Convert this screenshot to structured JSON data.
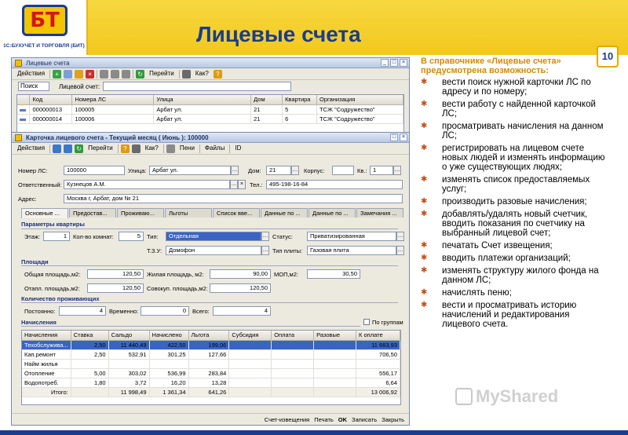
{
  "slide": {
    "title": "Лицевые счета",
    "logo_text": "БТ",
    "logo_caption": "1С:БУХУЧЕТ И ТОРГОВЛЯ (БИТ)",
    "page_number": "10",
    "watermark": "MyShared"
  },
  "list_window": {
    "title": "Лицевые счета",
    "toolbar": {
      "actions": "Действия",
      "goto": "Перейти",
      "help": "Как?"
    },
    "search_button": "Поиск",
    "search_label": "Лицевой счет:",
    "columns": [
      "Код",
      "Номера ЛС",
      "Улица",
      "Дом",
      "Квартира",
      "Организация"
    ],
    "rows": [
      [
        "000000013",
        "100005",
        "Арбат ул.",
        "21",
        "5",
        "ТСЖ \"Содружество\""
      ],
      [
        "000000014",
        "100006",
        "Арбат ул.",
        "21",
        "6",
        "ТСЖ \"Содружество\""
      ]
    ]
  },
  "card_window": {
    "title": "Карточка лицевого счета - Текущий месяц ( Июнь ): 100000",
    "toolbar": {
      "actions": "Действия",
      "goto": "Перейти",
      "help": "Как?",
      "penalty": "Пени",
      "files": "Файлы",
      "id": "ID"
    },
    "fields": {
      "account_label": "Номер ЛС:",
      "account_value": "100000",
      "street_label": "Улица:",
      "street_value": "Арбат ул.",
      "house_label": "Дом:",
      "house_value": "21",
      "building_label": "Корпус:",
      "building_value": "",
      "apartment_label": "Кв.:",
      "apartment_value": "1",
      "owner_label": "Ответственный:",
      "owner_value": "Кузнецов А.М.",
      "phone_label": "Тел.:",
      "phone_value": "495-198-16-84",
      "address_label": "Адрес:",
      "address_value": "Москва г, Арбат, дом № 21"
    },
    "tabs": [
      "Основные ...",
      "Предостав...",
      "Проживаю...",
      "Льготы",
      "Список вве...",
      "Данные по ...",
      "Данные по ...",
      "Замечания ..."
    ],
    "apartment_params": {
      "header": "Параметры квартиры",
      "floor_label": "Этаж:",
      "floor_value": "1",
      "rooms_label": "Кол-во комнат:",
      "rooms_value": "5",
      "type_label": "Тип:",
      "type_value": "Отдельная",
      "status_label": "Статус:",
      "status_value": "Приватизированная",
      "tzu_label": "Т.З.У:",
      "tzu_value": "Домофон",
      "stove_label": "Тип плиты:",
      "stove_value": "Газовая плита"
    },
    "areas": {
      "header": "Площади",
      "total_label": "Общая площадь,м2:",
      "total_value": "120,50",
      "living_label": "Жилая площадь, м2:",
      "living_value": "90,00",
      "mop_label": "МОП,м2:",
      "mop_value": "30,50",
      "heated_label": "Отапл. площадь,м2:",
      "heated_value": "120,50",
      "combined_label": "Совокуп. площадь,м2:",
      "combined_value": "120,50"
    },
    "residents": {
      "header": "Количество проживающих",
      "permanent_label": "Постоянно:",
      "permanent_value": "4",
      "temporary_label": "Временно:",
      "temporary_value": "0",
      "total_label": "Всего:",
      "total_value": "4"
    },
    "charges": {
      "header": "Начисления",
      "by_groups_label": "По группам",
      "columns": [
        "Начисления",
        "Ставка",
        "Сальдо",
        "Начислено",
        "Льгота",
        "Субсидия",
        "Оплата",
        "Разовые",
        "К оплате"
      ],
      "rows": [
        [
          "Техобслужива...",
          "2,50",
          "11 440,49",
          "422,50",
          "199,06",
          "",
          "",
          "",
          "11 663,93"
        ],
        [
          "Кап.ремонт",
          "2,50",
          "532,91",
          "301,25",
          "127,66",
          "",
          "",
          "",
          "706,50"
        ],
        [
          "Найм жилья",
          "",
          "",
          "",
          "",
          "",
          "",
          "",
          ""
        ],
        [
          "Отопление",
          "5,00",
          "303,02",
          "536,99",
          "283,84",
          "",
          "",
          "",
          "556,17"
        ],
        [
          "Водопотреб.",
          "1,80",
          "3,72",
          "16,20",
          "13,28",
          "",
          "",
          "",
          "6,64"
        ]
      ],
      "total_row": [
        "Итого:",
        "",
        "11 998,49",
        "1 361,34",
        "641,26",
        "",
        "",
        "",
        "13 006,92"
      ]
    },
    "bottom": {
      "notice": "Счет-извещения",
      "print": "Печать",
      "ok": "OK",
      "save": "Записать",
      "close": "Закрыть"
    }
  },
  "panel": {
    "intro": "В справочнике «Лицевые счета» предусмотрена возможность:",
    "items": [
      "вести поиск нужной карточки ЛС по адресу и по номеру;",
      "вести работу с найденной карточкой ЛС;",
      "просматривать начисления на данном ЛС;",
      "регистрировать на лицевом счете новых людей и изменять информацию о уже существующих людях;",
      "изменять список предоставляемых услуг;",
      "производить разовые начисления;",
      "добавлять/удалять новый счетчик, вводить показания по счетчику на выбранный лицевой счет;",
      "печатать Счет извещения;",
      "вводить платежи организаций;",
      "изменять структуру жилого фонда на данном ЛС;",
      "начислять пеню;",
      "вести и просматривать историю начислений и редактирования лицевого счета."
    ]
  },
  "colors": {
    "brand_blue": "#1a3c8f",
    "header_yellow": "#f2c81e",
    "accent_orange": "#d48a00"
  }
}
